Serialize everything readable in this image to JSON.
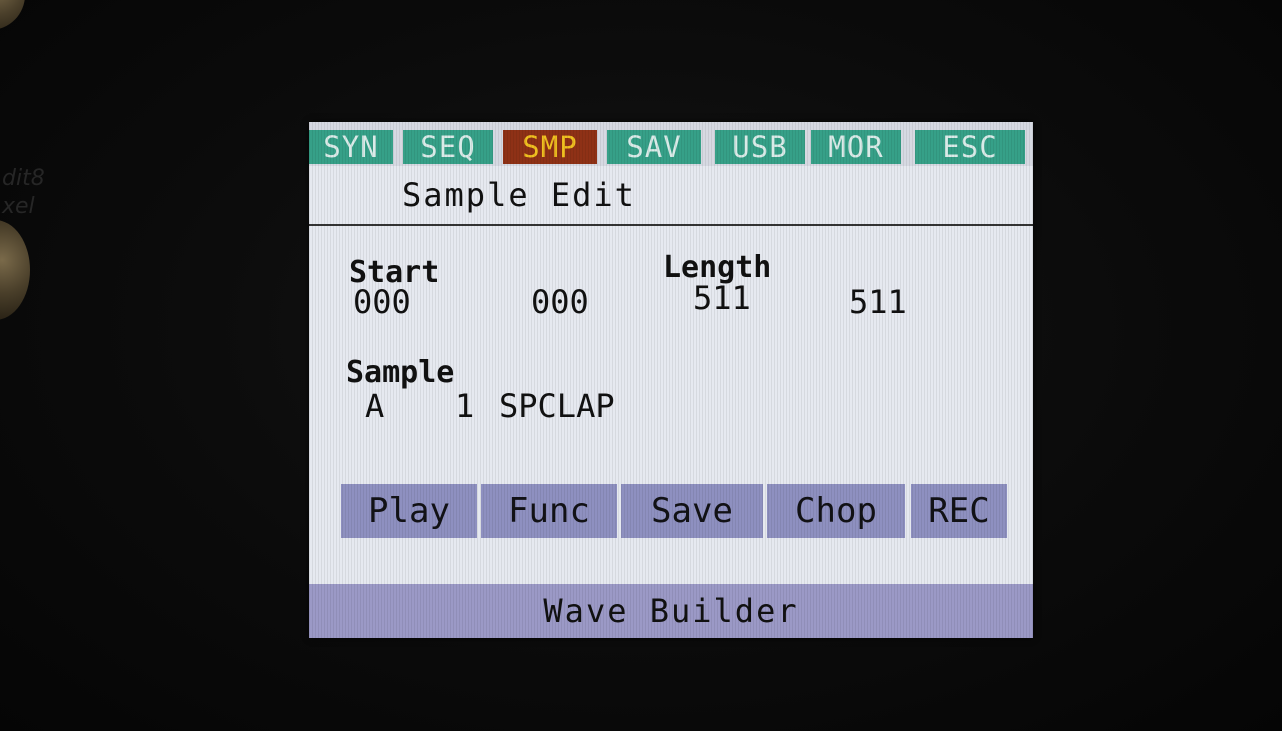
{
  "device": {
    "panel_print_1": "dit8",
    "panel_print_2": "xel"
  },
  "tabs": [
    {
      "label": "SYN",
      "active": false
    },
    {
      "label": "SEQ",
      "active": false
    },
    {
      "label": "SMP",
      "active": true
    },
    {
      "label": "SAV",
      "active": false
    },
    {
      "label": "USB",
      "active": false
    },
    {
      "label": "MOR",
      "active": false
    },
    {
      "label": "ESC",
      "active": false
    }
  ],
  "page_title": "Sample Edit",
  "fields": {
    "start_label": "Start",
    "start_coarse": "000",
    "start_fine": "000",
    "length_label": "Length",
    "length_coarse": "511",
    "length_fine": "511",
    "sample_label": "Sample",
    "sample_bank": "A",
    "sample_number": "1",
    "sample_name": "SPCLAP"
  },
  "softkeys": [
    "Play",
    "Func",
    "Save",
    "Chop",
    "REC"
  ],
  "bottom_bar": "Wave Builder",
  "colors": {
    "tab_inactive": "#36a088",
    "tab_active": "#8e3116",
    "tab_active_text": "#f0c020",
    "softkey": "#8e90c0",
    "bottom_bar": "#9b99c6",
    "screen_bg": "#e6e9f0"
  }
}
